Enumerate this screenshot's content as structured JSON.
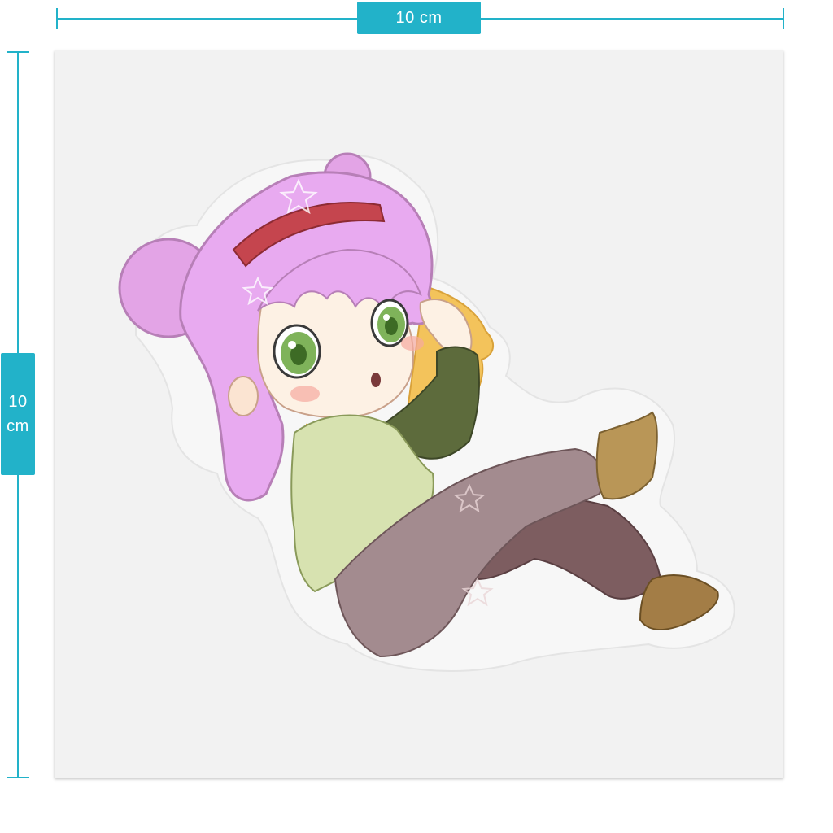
{
  "dimensions": {
    "width_label": "10 cm",
    "height_label_line1": "10",
    "height_label_line2": "cm"
  },
  "colors": {
    "accent": "#22b2c9",
    "sheet": "#f2f2f2",
    "hair": "#e5a8e9",
    "headband": "#c5454e",
    "eyes": "#7fb35a",
    "sweater": "#d7e2b0",
    "sleeve": "#5d6b3c",
    "pants": "#8e7375",
    "boots": "#b99657"
  },
  "sticker": {
    "subject": "chibi-girl-sticker"
  }
}
